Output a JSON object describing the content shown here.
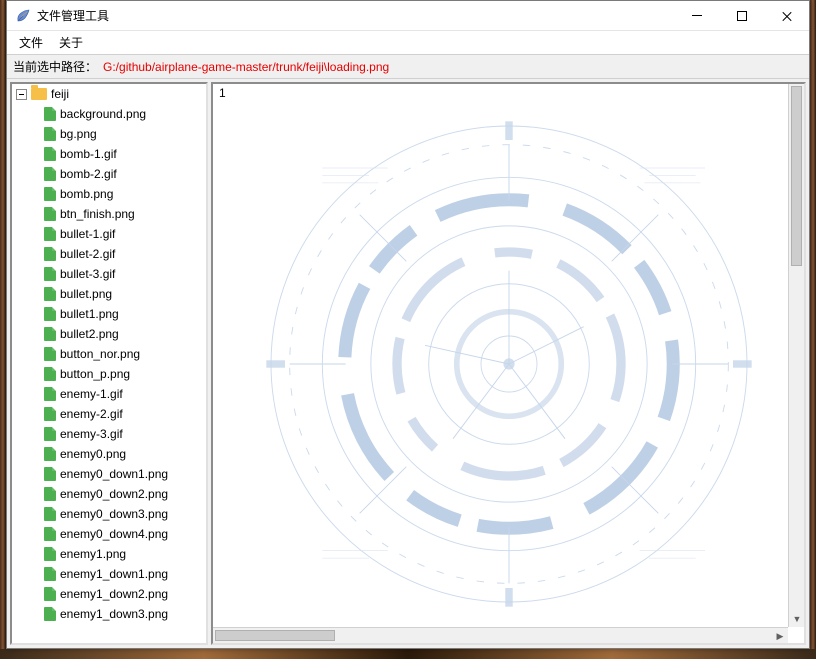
{
  "window": {
    "title": "文件管理工具"
  },
  "menu": {
    "file": "文件",
    "about": "关于"
  },
  "path": {
    "label": "当前选中路径：",
    "value": "G:/github/airplane-game-master/trunk/feiji\\loading.png"
  },
  "tree": {
    "root": {
      "name": "feiji"
    },
    "files": [
      "background.png",
      "bg.png",
      "bomb-1.gif",
      "bomb-2.gif",
      "bomb.png",
      "btn_finish.png",
      "bullet-1.gif",
      "bullet-2.gif",
      "bullet-3.gif",
      "bullet.png",
      "bullet1.png",
      "bullet2.png",
      "button_nor.png",
      "button_p.png",
      "enemy-1.gif",
      "enemy-2.gif",
      "enemy-3.gif",
      "enemy0.png",
      "enemy0_down1.png",
      "enemy0_down2.png",
      "enemy0_down3.png",
      "enemy0_down4.png",
      "enemy1.png",
      "enemy1_down1.png",
      "enemy1_down2.png",
      "enemy1_down3.png"
    ]
  },
  "preview": {
    "label": "1"
  }
}
